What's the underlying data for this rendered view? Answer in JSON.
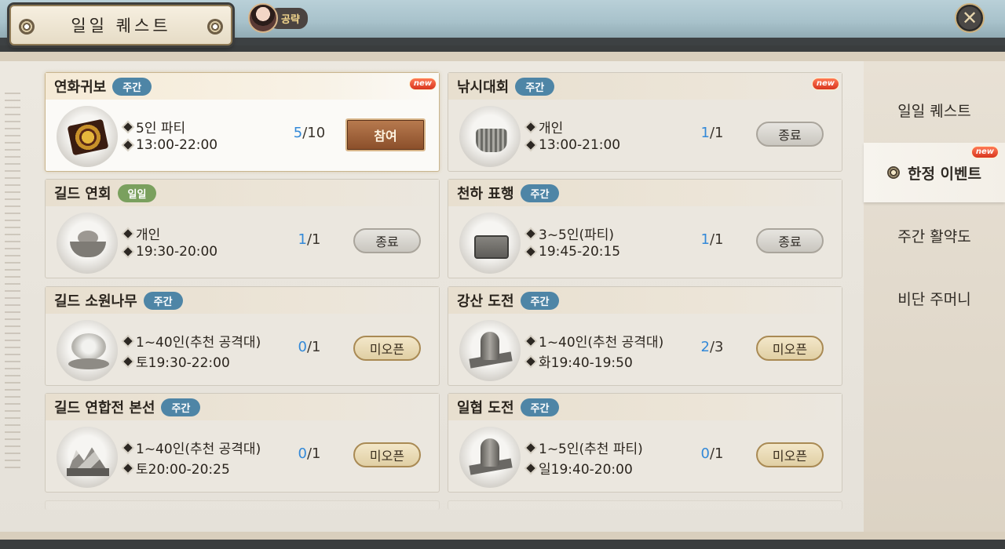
{
  "header": {
    "title": "일일 퀘스트",
    "guide_label": "공략",
    "close_icon": "✕"
  },
  "sidebar": {
    "items": [
      {
        "label": "일일 퀘스트",
        "active": false
      },
      {
        "label": "한정 이벤트",
        "active": true,
        "new": "new"
      },
      {
        "label": "주간 활약도",
        "active": false
      },
      {
        "label": "비단 주머니",
        "active": false
      }
    ]
  },
  "cards": [
    {
      "title": "연화귀보",
      "tag": "주간",
      "new": "new",
      "line1": "5인 파티",
      "line2": "13:00-22:00",
      "current": "5",
      "total": "/10",
      "button": "참여",
      "icon": "board-icon"
    },
    {
      "title": "낚시대회",
      "tag": "주간",
      "new": "new",
      "line1": "개인",
      "line2": "13:00-21:00",
      "current": "1",
      "total": "/1",
      "button": "종료",
      "icon": "fish-basket-icon"
    },
    {
      "title": "길드 연회",
      "tag": "일일",
      "line1": "개인",
      "line2": "19:30-20:00",
      "current": "1",
      "total": "/1",
      "button": "종료",
      "icon": "feast-icon"
    },
    {
      "title": "천하 표행",
      "tag": "주간",
      "line1": "3~5인(파티)",
      "line2": "19:45-20:15",
      "current": "1",
      "total": "/1",
      "button": "종료",
      "icon": "chest-icon"
    },
    {
      "title": "길드 소원나무",
      "tag": "주간",
      "line1": "1~40인(추천 공격대)",
      "line2": "토19:30-22:00",
      "current": "0",
      "total": "/1",
      "button": "미오픈",
      "icon": "tree-icon"
    },
    {
      "title": "강산 도전",
      "tag": "주간",
      "line1": "1~40인(추천 공격대)",
      "line2": "화19:40-19:50",
      "current": "2",
      "total": "/3",
      "button": "미오픈",
      "icon": "helmet-icon"
    },
    {
      "title": "길드 연합전 본선",
      "tag": "주간",
      "line1": "1~40인(추천 공격대)",
      "line2": "토20:00-20:25",
      "current": "0",
      "total": "/1",
      "button": "미오픈",
      "icon": "mountain-icon"
    },
    {
      "title": "일협 도전",
      "tag": "주간",
      "line1": "1~5인(추천 파티)",
      "line2": "일19:40-20:00",
      "current": "0",
      "total": "/1",
      "button": "미오픈",
      "icon": "helmet-icon"
    }
  ],
  "colors": {
    "accent_blue": "#3389d8",
    "weekly_tag": "#4e85a6",
    "daily_tag": "#7aa05e",
    "join_button": "#8a4e2a"
  }
}
